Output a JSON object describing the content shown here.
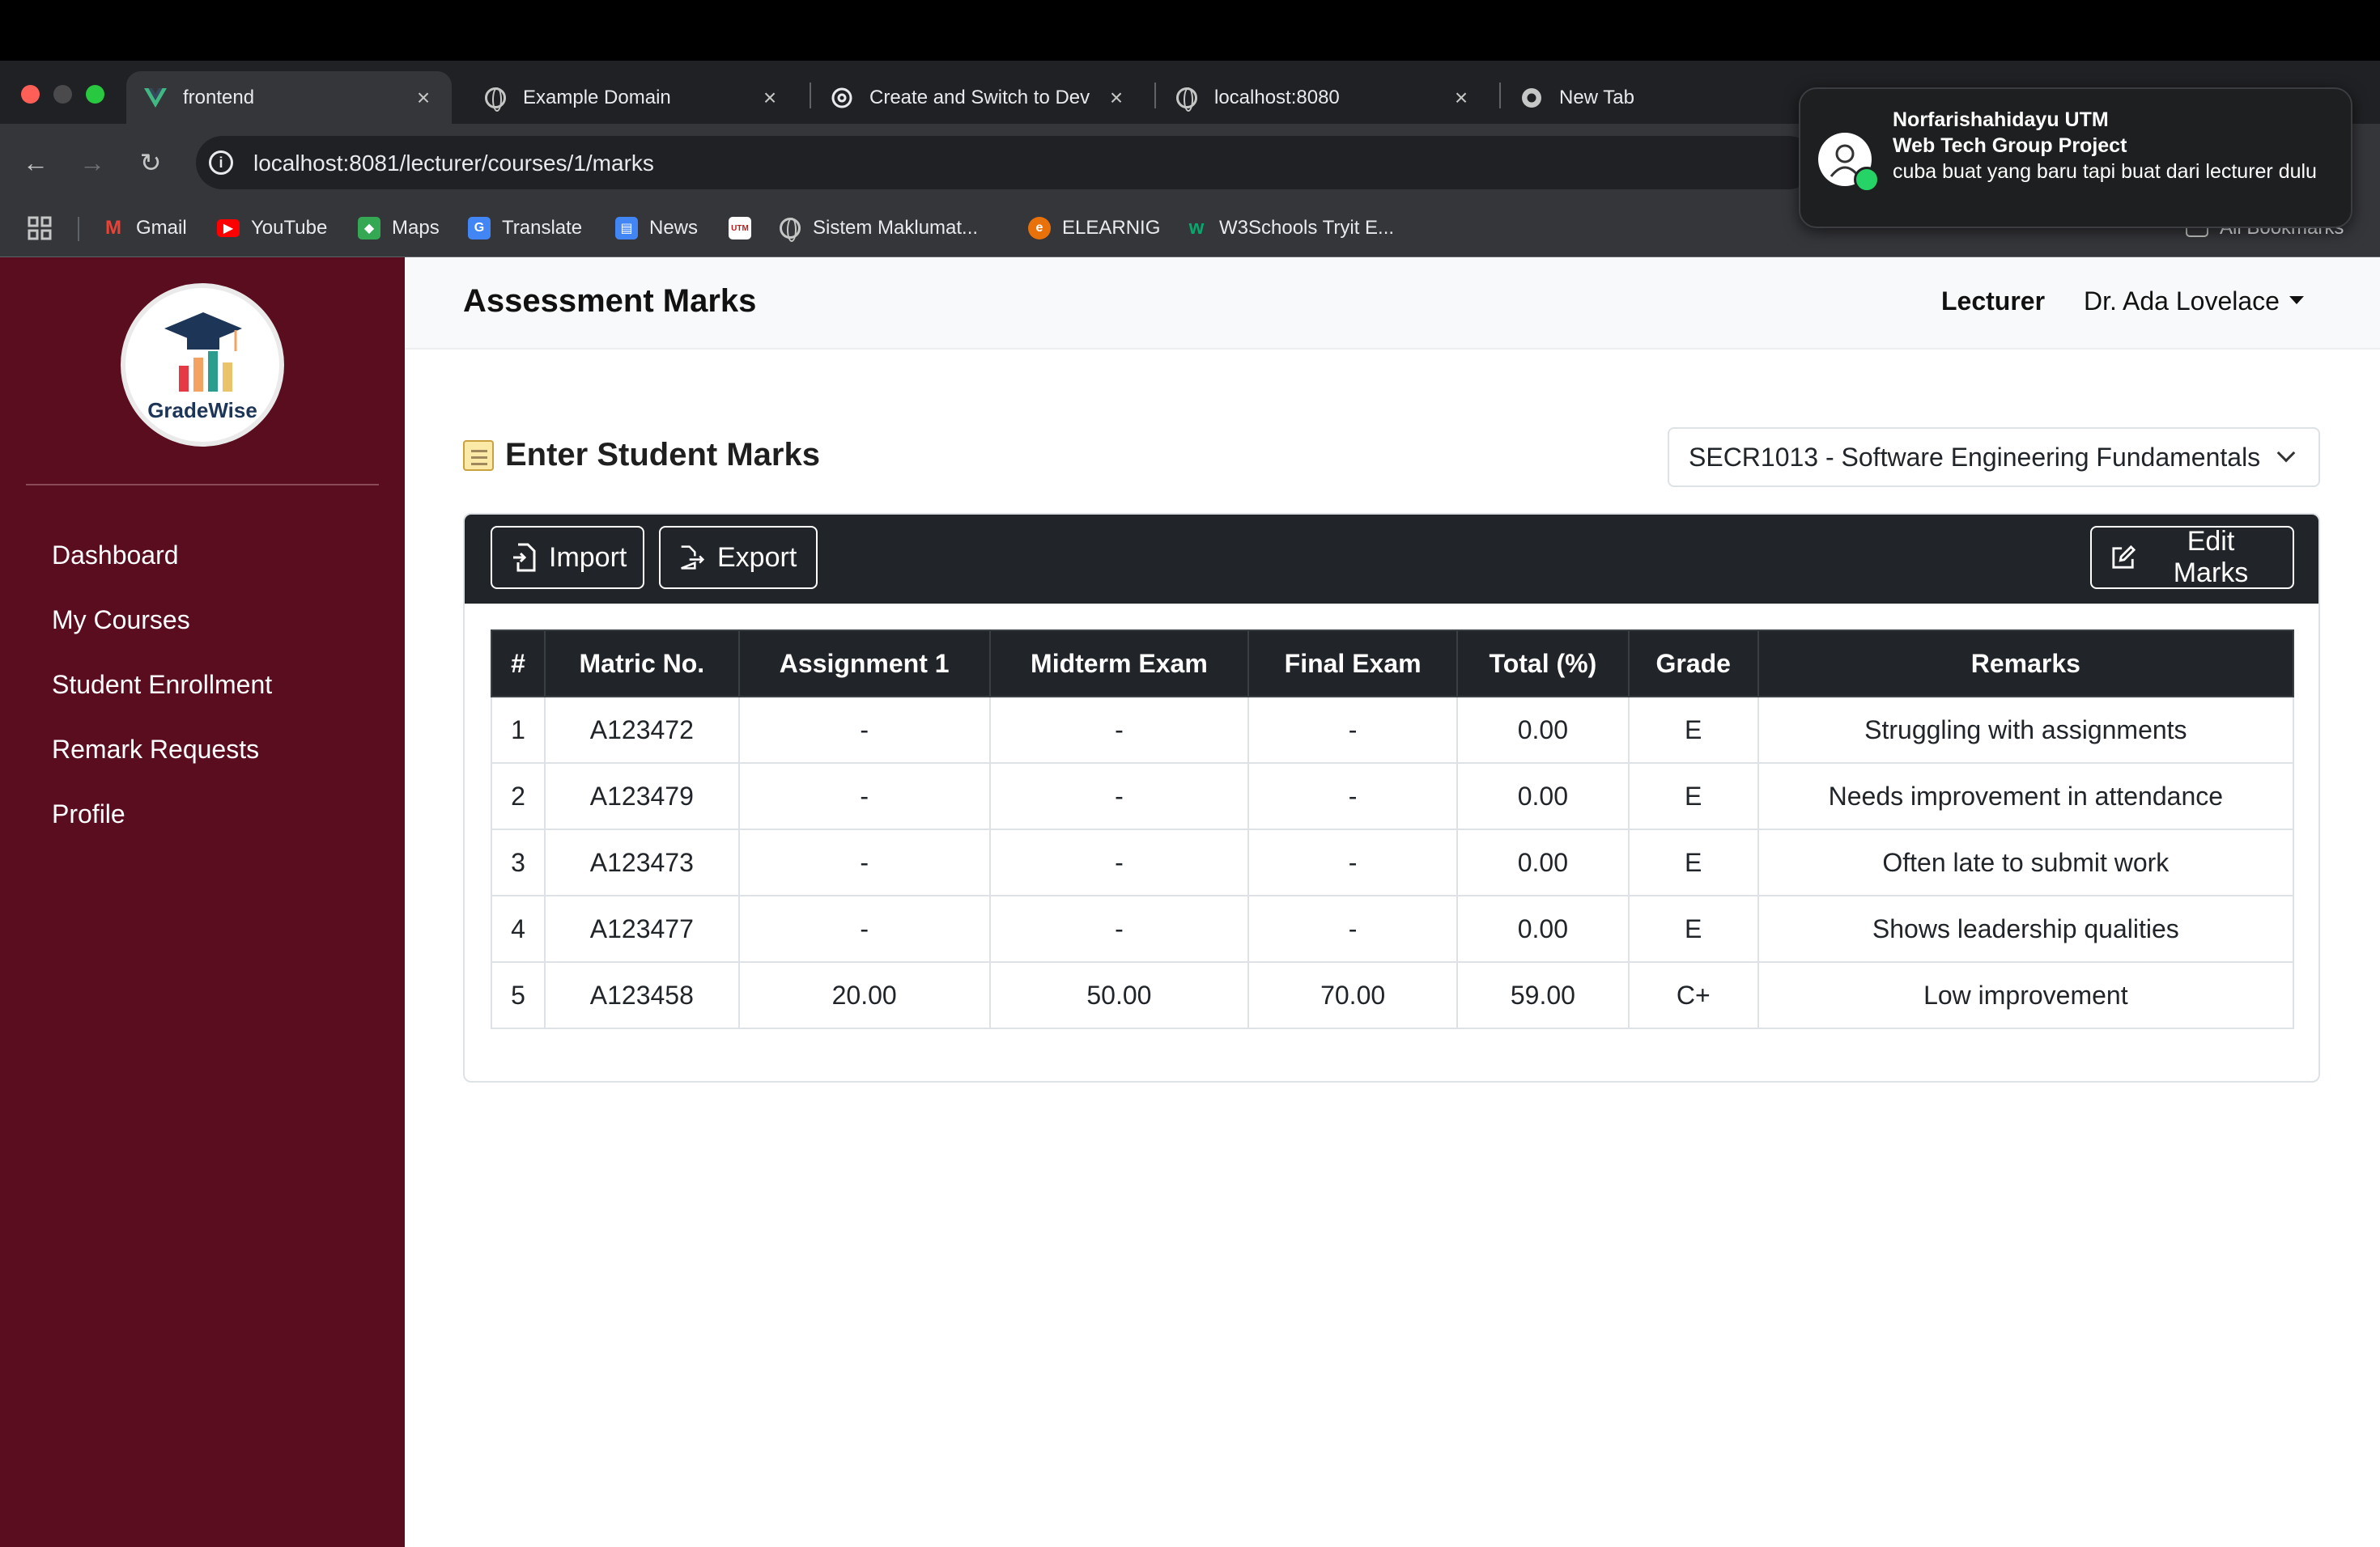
{
  "browser": {
    "tabs": [
      {
        "title": "frontend",
        "icon": "vue-icon",
        "active": true
      },
      {
        "title": "Example Domain",
        "icon": "globe-icon"
      },
      {
        "title": "Create and Switch to Dev",
        "icon": "openai-icon"
      },
      {
        "title": "localhost:8080",
        "icon": "globe-icon"
      },
      {
        "title": "New Tab",
        "icon": "chrome-icon"
      }
    ],
    "url": "localhost:8081/lecturer/courses/1/marks",
    "bookmarks": [
      {
        "label": "Gmail",
        "icon": "gmail-icon",
        "color": "#ea4335"
      },
      {
        "label": "YouTube",
        "icon": "youtube-icon",
        "color": "#ff0000"
      },
      {
        "label": "Maps",
        "icon": "maps-icon",
        "color": "#34a853"
      },
      {
        "label": "Translate",
        "icon": "translate-icon",
        "color": "#4285f4"
      },
      {
        "label": "News",
        "icon": "news-icon",
        "color": "#4285f4"
      },
      {
        "label": "Sistem Maklumat...",
        "icon": "globe-icon",
        "color": "#9aa0a6"
      },
      {
        "label": "ELEARNIG",
        "icon": "elearning-icon",
        "color": "#e8710a"
      },
      {
        "label": "W3Schools Tryit E...",
        "icon": "w3schools-icon",
        "color": "#04aa6d"
      }
    ],
    "all_bookmarks": "All Bookmarks"
  },
  "notification": {
    "sender": "Norfarishahidayu UTM",
    "group": "Web Tech Group Project",
    "message": "cuba buat yang baru tapi buat dari lecturer dulu"
  },
  "sidebar": {
    "logo_text": "GradeWise",
    "items": [
      "Dashboard",
      "My Courses",
      "Student Enrollment",
      "Remark Requests",
      "Profile"
    ]
  },
  "header": {
    "title": "Assessment Marks",
    "role": "Lecturer",
    "user": "Dr. Ada Lovelace"
  },
  "main": {
    "section_title": "Enter Student Marks",
    "course": "SECR1013 - Software Engineering Fundamentals",
    "buttons": {
      "import": "Import",
      "export": "Export",
      "edit": "Edit Marks"
    },
    "table": {
      "headers": [
        "#",
        "Matric No.",
        "Assignment 1",
        "Midterm Exam",
        "Final Exam",
        "Total (%)",
        "Grade",
        "Remarks"
      ],
      "rows": [
        [
          "1",
          "A123472",
          "-",
          "-",
          "-",
          "0.00",
          "E",
          "Struggling with assignments"
        ],
        [
          "2",
          "A123479",
          "-",
          "-",
          "-",
          "0.00",
          "E",
          "Needs improvement in attendance"
        ],
        [
          "3",
          "A123473",
          "-",
          "-",
          "-",
          "0.00",
          "E",
          "Often late to submit work"
        ],
        [
          "4",
          "A123477",
          "-",
          "-",
          "-",
          "0.00",
          "E",
          "Shows leadership qualities"
        ],
        [
          "5",
          "A123458",
          "20.00",
          "50.00",
          "70.00",
          "59.00",
          "C+",
          "Low improvement"
        ]
      ]
    }
  },
  "colors": {
    "sidebar": "#5a0d1f",
    "dark": "#212529"
  }
}
